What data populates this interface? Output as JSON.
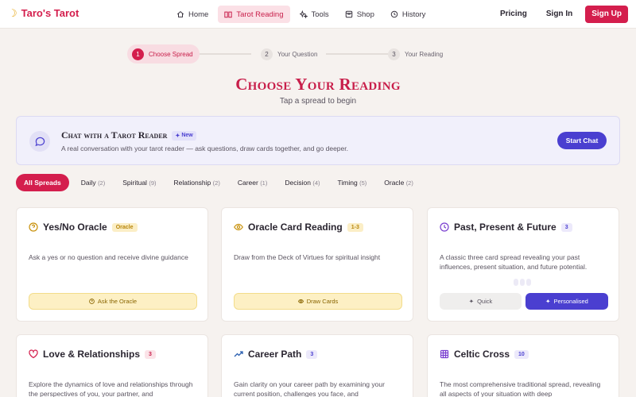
{
  "brand": {
    "name": "Taro's Tarot",
    "icon": "crescent-moon-icon"
  },
  "nav": {
    "items": [
      {
        "label": "Home",
        "icon": "home-icon"
      },
      {
        "label": "Tarot Reading",
        "icon": "book-icon",
        "active": true
      },
      {
        "label": "Tools",
        "icon": "sparkles-icon"
      },
      {
        "label": "Shop",
        "icon": "shop-icon"
      },
      {
        "label": "History",
        "icon": "clock-icon"
      }
    ],
    "pricing": "Pricing",
    "sign_in": "Sign In",
    "sign_up": "Sign Up"
  },
  "stepper": {
    "steps": [
      {
        "num": "1",
        "label": "Choose Spread",
        "active": true
      },
      {
        "num": "2",
        "label": "Your Question"
      },
      {
        "num": "3",
        "label": "Your Reading"
      }
    ]
  },
  "page": {
    "title": "Choose Your Reading",
    "subtitle": "Tap a spread to begin"
  },
  "chat_banner": {
    "title": "Chat with a Tarot Reader",
    "badge": "New",
    "description": "A real conversation with your tarot reader — ask questions, draw cards together, and go deeper.",
    "button": "Start Chat"
  },
  "filters": [
    {
      "label": "All Spreads",
      "count": "",
      "active": true
    },
    {
      "label": "Daily",
      "count": "(2)"
    },
    {
      "label": "Spiritual",
      "count": "(9)"
    },
    {
      "label": "Relationship",
      "count": "(2)"
    },
    {
      "label": "Career",
      "count": "(1)"
    },
    {
      "label": "Decision",
      "count": "(4)"
    },
    {
      "label": "Timing",
      "count": "(5)"
    },
    {
      "label": "Oracle",
      "count": "(2)"
    }
  ],
  "cards": [
    {
      "title": "Yes/No Oracle",
      "badge": "Oracle",
      "description": "Ask a yes or no question and receive divine guidance",
      "button": "Ask the Oracle",
      "icon": "help-circle-icon"
    },
    {
      "title": "Oracle Card Reading",
      "badge": "1-3",
      "description": "Draw from the Deck of Virtues for spiritual insight",
      "button": "Draw Cards",
      "icon": "eye-icon"
    },
    {
      "title": "Past, Present & Future",
      "badge": "3",
      "description": "A classic three card spread revealing your past influences, present situation, and future potential.",
      "quick": "Quick",
      "personalised": "Personalised",
      "icon": "clock-icon"
    },
    {
      "title": "Love & Relationships",
      "badge": "3",
      "description": "Explore the dynamics of love and relationships through the perspectives of you, your partner, and",
      "icon": "heart-icon"
    },
    {
      "title": "Career Path",
      "badge": "3",
      "description": "Gain clarity on your career path by examining your current position, challenges you face, and",
      "icon": "trending-up-icon"
    },
    {
      "title": "Celtic Cross",
      "badge": "10",
      "description": "The most comprehensive traditional spread, revealing all aspects of your situation with deep",
      "icon": "grid-icon"
    }
  ],
  "colors": {
    "brand": "#d41e4d",
    "accent": "#4a3fd0",
    "oracle_yellow": "#fdf0c4",
    "background": "#f6f2ef"
  }
}
